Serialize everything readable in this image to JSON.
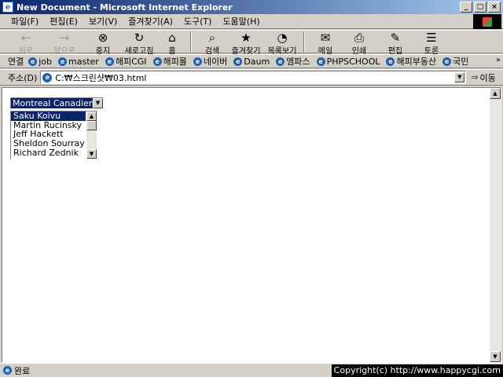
{
  "window": {
    "title": "New Document - Microsoft Internet Explorer",
    "app_icon_glyph": "e",
    "buttons": {
      "minimize": "_",
      "maximize": "□",
      "close": "×"
    }
  },
  "menu": [
    "파일(F)",
    "편집(E)",
    "보기(V)",
    "즐겨찾기(A)",
    "도구(T)",
    "도움말(H)"
  ],
  "toolbar": {
    "back": "뒤로",
    "forward": "앞으로",
    "stop": "중지",
    "refresh": "새로고침",
    "home": "홈",
    "search": "검색",
    "favorites": "즐겨찾기",
    "history": "목록보기",
    "mail": "메일",
    "print": "인쇄",
    "edit": "편집",
    "discuss": "토론"
  },
  "links": {
    "label": "연결",
    "items": [
      "job",
      "master",
      "해피CGI",
      "해피몰",
      "네이버",
      "Daum",
      "엠파스",
      "PHPSCHOOL",
      "해피부동산",
      "국민"
    ],
    "more": "»"
  },
  "address": {
    "label": "주소(D)",
    "value": "C:₩스크린샷₩03.html",
    "go": "이동"
  },
  "form": {
    "select_value": "Montreal Canadiens",
    "list_items": [
      "Saku Koivu",
      "Martin Rucinsky",
      "Jeff Hackett",
      "Sheldon Sourray",
      "Richard Zednik"
    ],
    "selected_index": 0
  },
  "status": {
    "text": "완료",
    "copyright": "Copyright(c) http://www.happycgi.com"
  },
  "colors": {
    "selection": "#0a246a",
    "title_gradient_start": "#0a246a",
    "title_gradient_end": "#a6caf0",
    "ie_blue": "#1d5fbf"
  }
}
